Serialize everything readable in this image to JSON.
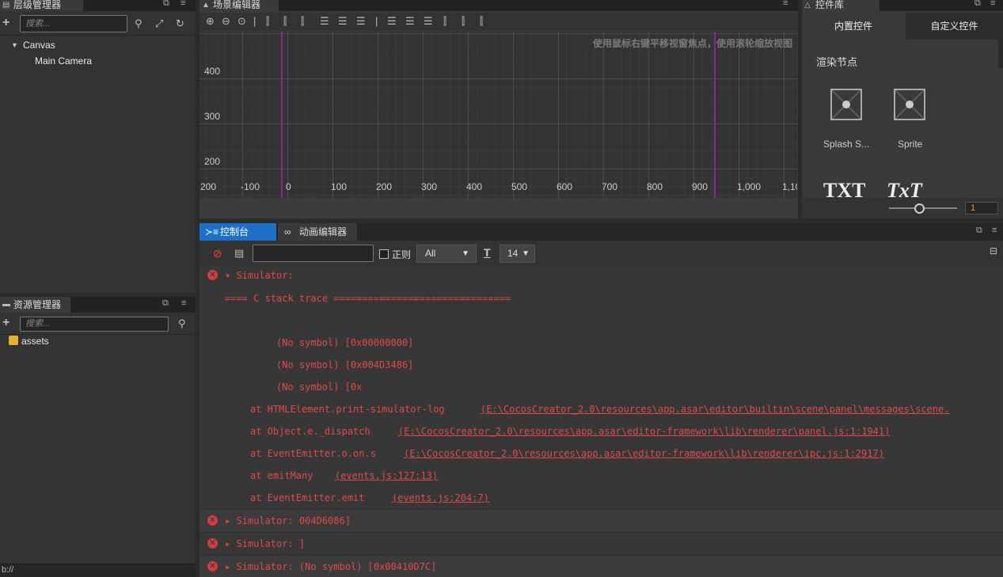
{
  "hierarchy": {
    "title": "层级管理器",
    "search_placeholder": "搜索...",
    "items": [
      "Canvas",
      "Main Camera"
    ]
  },
  "scene": {
    "title": "场景编辑器",
    "hint": "使用鼠标右键平移视窗焦点，使用滚轮缩放视图",
    "y_labels": [
      "400",
      "300",
      "200"
    ],
    "x_labels": [
      "200",
      "-100",
      "0",
      "100",
      "200",
      "300",
      "400",
      "500",
      "600",
      "700",
      "800",
      "900",
      "1,000",
      "1,10"
    ]
  },
  "widgets": {
    "title": "控件库",
    "tab_builtin": "内置控件",
    "tab_custom": "自定义控件",
    "section": "渲染节点",
    "items": [
      "Splash S...",
      "Sprite"
    ],
    "more_items": [
      "TXT",
      "TxT"
    ],
    "zoom_value": "1"
  },
  "assets": {
    "title": "资源管理器",
    "search_placeholder": "搜索...",
    "root": "assets",
    "status": "b://"
  },
  "console": {
    "tab_console": "控制台",
    "tab_animation": "动画编辑器",
    "regex_label": "正则",
    "filter_value": "All",
    "font_size": "14",
    "logs": [
      {
        "text": "▾ Simulator:",
        "kind": "header"
      },
      {
        "text": "==== C stack trace ===============================",
        "kind": "plain"
      },
      {
        "text": "",
        "kind": "plain"
      },
      {
        "text": "(No symbol) [0x00000000]",
        "kind": "indent2"
      },
      {
        "text": "(No symbol) [0x004D3486]",
        "kind": "indent2"
      },
      {
        "text": "(No symbol) [0x",
        "kind": "indent2"
      },
      {
        "text": "at HTMLElement.print-simulator-log",
        "link": "(E:\\CocosCreator_2.0\\resources\\app.asar\\editor\\builtin\\scene\\panel\\messages\\scene.",
        "kind": "indent1"
      },
      {
        "text": "at Object.e._dispatch",
        "link": "(E:\\CocosCreator_2.0\\resources\\app.asar\\editor-framework\\lib\\renderer\\panel.js:1:1941)",
        "kind": "indent1"
      },
      {
        "text": "at EventEmitter.o.on.s",
        "link": "(E:\\CocosCreator_2.0\\resources\\app.asar\\editor-framework\\lib\\renderer\\ipc.js:1:2917)",
        "kind": "indent1"
      },
      {
        "text": "at emitMany",
        "link": "(events.js:127:13)",
        "kind": "indent1"
      },
      {
        "text": "at EventEmitter.emit",
        "link": "(events.js:204:7)",
        "kind": "indent1"
      },
      {
        "text": "▸ Simulator: 004D6086]",
        "kind": "header"
      },
      {
        "text": "▸ Simulator: ]",
        "kind": "header"
      },
      {
        "text": "▸ Simulator: (No symbol) [0x00410D7C]",
        "kind": "header"
      }
    ]
  }
}
